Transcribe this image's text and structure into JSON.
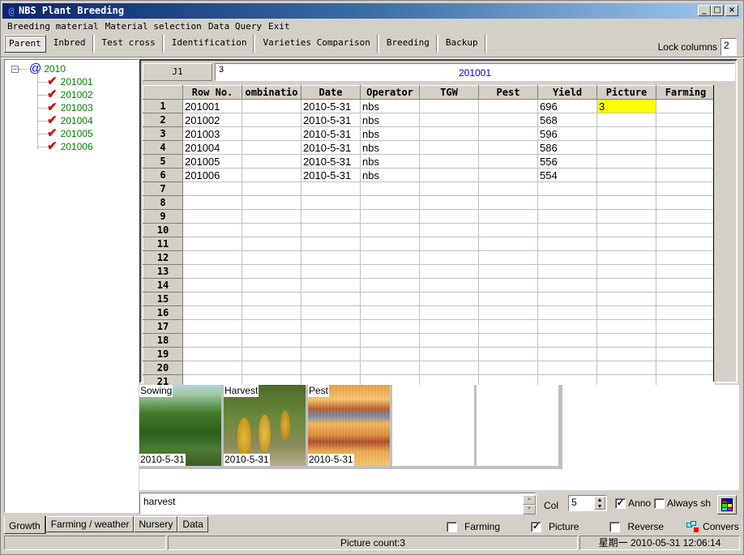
{
  "window": {
    "title": "NBS Plant Breeding",
    "controls": [
      "minimize",
      "maximize",
      "close"
    ]
  },
  "menu": [
    "Breeding material",
    "Material selection",
    "Data Query",
    "Exit"
  ],
  "top_tabs": {
    "items": [
      "Parent",
      "Inbred",
      "Test cross",
      "Identification",
      "Varieties Comparison",
      "Breeding",
      "Backup"
    ],
    "active": "Parent"
  },
  "lock_columns": {
    "label": "Lock columns",
    "value": "2"
  },
  "tree": {
    "root": "2010",
    "children": [
      "201001",
      "201002",
      "201003",
      "201004",
      "201005",
      "201006"
    ]
  },
  "cell_ref": "J1",
  "formula": {
    "value": "3",
    "caption": "201001"
  },
  "grid": {
    "columns": [
      "Row No.",
      "ombinatio",
      "Date",
      "Operator",
      "TGW",
      "Pest",
      "Yield",
      "Picture",
      "Farming"
    ],
    "rows": [
      {
        "n": "1",
        "cells": [
          "201001",
          "",
          "2010-5-31",
          "nbs",
          "",
          "",
          "696",
          "3",
          ""
        ]
      },
      {
        "n": "2",
        "cells": [
          "201002",
          "",
          "2010-5-31",
          "nbs",
          "",
          "",
          "568",
          "",
          ""
        ]
      },
      {
        "n": "3",
        "cells": [
          "201003",
          "",
          "2010-5-31",
          "nbs",
          "",
          "",
          "596",
          "",
          ""
        ]
      },
      {
        "n": "4",
        "cells": [
          "201004",
          "",
          "2010-5-31",
          "nbs",
          "",
          "",
          "586",
          "",
          ""
        ]
      },
      {
        "n": "5",
        "cells": [
          "201005",
          "",
          "2010-5-31",
          "nbs",
          "",
          "",
          "556",
          "",
          ""
        ]
      },
      {
        "n": "6",
        "cells": [
          "201006",
          "",
          "2010-5-31",
          "nbs",
          "",
          "",
          "554",
          "",
          ""
        ]
      },
      {
        "n": "7",
        "cells": [
          "",
          "",
          "",
          "",
          "",
          "",
          "",
          "",
          ""
        ]
      },
      {
        "n": "8",
        "cells": [
          "",
          "",
          "",
          "",
          "",
          "",
          "",
          "",
          ""
        ]
      },
      {
        "n": "9",
        "cells": [
          "",
          "",
          "",
          "",
          "",
          "",
          "",
          "",
          ""
        ]
      },
      {
        "n": "10",
        "cells": [
          "",
          "",
          "",
          "",
          "",
          "",
          "",
          "",
          ""
        ]
      },
      {
        "n": "11",
        "cells": [
          "",
          "",
          "",
          "",
          "",
          "",
          "",
          "",
          ""
        ]
      },
      {
        "n": "12",
        "cells": [
          "",
          "",
          "",
          "",
          "",
          "",
          "",
          "",
          ""
        ]
      },
      {
        "n": "13",
        "cells": [
          "",
          "",
          "",
          "",
          "",
          "",
          "",
          "",
          ""
        ]
      },
      {
        "n": "14",
        "cells": [
          "",
          "",
          "",
          "",
          "",
          "",
          "",
          "",
          ""
        ]
      },
      {
        "n": "15",
        "cells": [
          "",
          "",
          "",
          "",
          "",
          "",
          "",
          "",
          ""
        ]
      },
      {
        "n": "16",
        "cells": [
          "",
          "",
          "",
          "",
          "",
          "",
          "",
          "",
          ""
        ]
      },
      {
        "n": "17",
        "cells": [
          "",
          "",
          "",
          "",
          "",
          "",
          "",
          "",
          ""
        ]
      },
      {
        "n": "18",
        "cells": [
          "",
          "",
          "",
          "",
          "",
          "",
          "",
          "",
          ""
        ]
      },
      {
        "n": "19",
        "cells": [
          "",
          "",
          "",
          "",
          "",
          "",
          "",
          "",
          ""
        ]
      },
      {
        "n": "20",
        "cells": [
          "",
          "",
          "",
          "",
          "",
          "",
          "",
          "",
          ""
        ]
      },
      {
        "n": "21",
        "cells": [
          "",
          "",
          "",
          "",
          "",
          "",
          "",
          "",
          ""
        ]
      }
    ],
    "highlight_color": "#ffff00"
  },
  "pictures": [
    {
      "label": "Sowing",
      "date": "2010-5-31",
      "kind": "sowing"
    },
    {
      "label": "Harvest",
      "date": "2010-5-31",
      "kind": "harvest",
      "selected": true
    },
    {
      "label": "Pest",
      "date": "2010-5-31",
      "kind": "pest"
    },
    {
      "label": "",
      "date": "",
      "kind": "empty"
    },
    {
      "label": "",
      "date": "",
      "kind": "empty"
    }
  ],
  "annotation_text": "harvest",
  "col_control": {
    "label": "Col",
    "value": "5"
  },
  "anno_checkbox": {
    "label": "Anno",
    "checked": true
  },
  "always_checkbox": {
    "label": "Always sh",
    "checked": false
  },
  "bottom_tabs": {
    "items": [
      "Growth",
      "Farming / weather",
      "Nursery",
      "Data"
    ],
    "active": "Growth"
  },
  "options": {
    "farming": {
      "label": "Farming",
      "checked": false
    },
    "picture": {
      "label": "Picture",
      "checked": true
    },
    "reverse": {
      "label": "Reverse",
      "checked": false
    },
    "convert": {
      "label": "Convers"
    }
  },
  "status": {
    "left": "",
    "center": "Picture count:3",
    "right": "星期一  2010-05-31  12:06:14"
  }
}
